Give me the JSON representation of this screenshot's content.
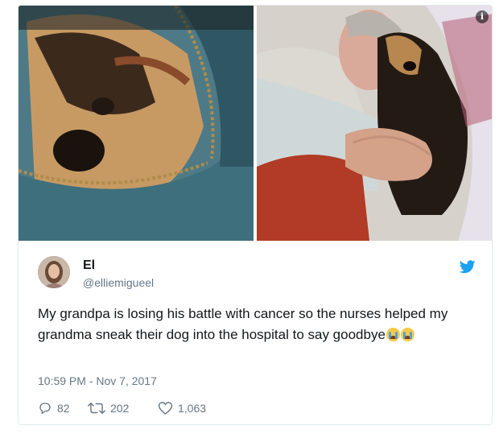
{
  "tweet": {
    "display_name": "El",
    "handle": "@elliemigueel",
    "text": "My grandpa is losing his battle with cancer so the nurses helped my grandma sneak their dog into the hospital to say goodbye",
    "timestamp": "10:59 PM - Nov 7, 2017",
    "info_symbol": "i"
  },
  "stats": {
    "replies": "82",
    "retweets": "202",
    "likes": "1,063"
  },
  "colors": {
    "twitter_blue": "#1da1f2",
    "text": "#14171a",
    "muted": "#657786",
    "border": "#e1e8ed"
  },
  "icons": [
    "info-icon",
    "twitter-bird-icon",
    "reply-icon",
    "retweet-icon",
    "heart-icon",
    "crying-face-emoji"
  ]
}
